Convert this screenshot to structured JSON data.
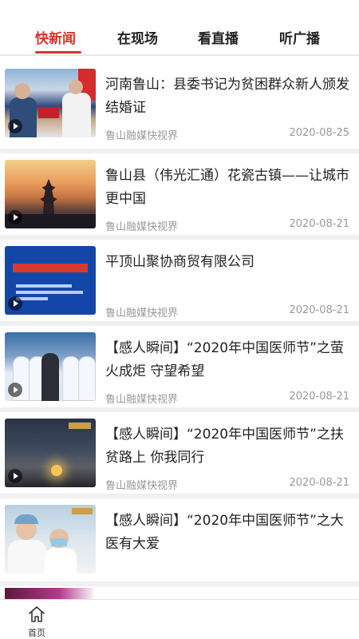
{
  "tabs": [
    {
      "label": "快新闻",
      "active": true
    },
    {
      "label": "在现场",
      "active": false
    },
    {
      "label": "看直播",
      "active": false
    },
    {
      "label": "听广播",
      "active": false
    }
  ],
  "accent_color": "#d9342b",
  "articles": [
    {
      "title": "河南鲁山：县委书记为贫困群众新人颁发结婚证",
      "source": "鲁山融媒快视界",
      "date": "2020-08-25",
      "has_video": true
    },
    {
      "title": "鲁山县（伟光汇通）花瓷古镇——让城市更中国",
      "source": "鲁山融媒快视界",
      "date": "2020-08-21",
      "has_video": true
    },
    {
      "title": "平顶山聚协商贸有限公司",
      "source": "鲁山融媒快视界",
      "date": "2020-08-21",
      "has_video": true
    },
    {
      "title": "【感人瞬间】“2020年中国医师节”之萤火成炬 守望希望",
      "source": "鲁山融媒快视界",
      "date": "2020-08-21",
      "has_video": true
    },
    {
      "title": "【感人瞬间】“2020年中国医师节”之扶贫路上 你我同行",
      "source": "鲁山融媒快视界",
      "date": "2020-08-21",
      "has_video": true
    },
    {
      "title": "【感人瞬间】“2020年中国医师节”之大医有大爱",
      "source": "",
      "date": "",
      "has_video": false
    }
  ],
  "bottom_nav": {
    "home_label": "首页",
    "home_icon": "home-icon"
  }
}
